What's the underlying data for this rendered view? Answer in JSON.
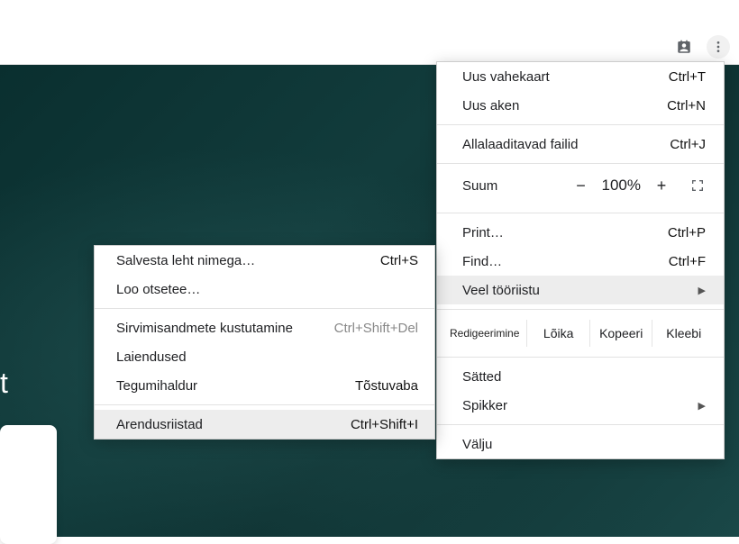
{
  "partial_text": "t",
  "main_menu": {
    "new_tab": {
      "label": "Uus vahekaart",
      "shortcut": "Ctrl+T"
    },
    "new_window": {
      "label": "Uus aken",
      "shortcut": "Ctrl+N"
    },
    "downloads": {
      "label": "Allalaaditavad failid",
      "shortcut": "Ctrl+J"
    },
    "zoom": {
      "label": "Suum",
      "minus": "−",
      "pct": "100%",
      "plus": "+"
    },
    "print": {
      "label": "Print…",
      "shortcut": "Ctrl+P"
    },
    "find": {
      "label": "Find…",
      "shortcut": "Ctrl+F"
    },
    "more_tools": {
      "label": "Veel tööriistu",
      "arrow": "▶"
    },
    "edit": {
      "label": "Redigeerimine",
      "cut": "Lõika",
      "copy": "Kopeeri",
      "paste": "Kleebi"
    },
    "settings": {
      "label": "Sätted"
    },
    "help": {
      "label": "Spikker",
      "arrow": "▶"
    },
    "exit": {
      "label": "Välju"
    }
  },
  "sub_menu": {
    "save_as": {
      "label": "Salvesta leht nimega…",
      "shortcut": "Ctrl+S"
    },
    "shortcut": {
      "label": "Loo otsetee…"
    },
    "clear_data": {
      "label": "Sirvimisandmete kustutamine",
      "shortcut": "Ctrl+Shift+Del"
    },
    "extensions": {
      "label": "Laiendused"
    },
    "task_mgr": {
      "label": "Tegumihaldur",
      "shortcut": "Tõstuvaba"
    },
    "dev_tools": {
      "label": "Arendusriistad",
      "shortcut": "Ctrl+Shift+I"
    }
  }
}
